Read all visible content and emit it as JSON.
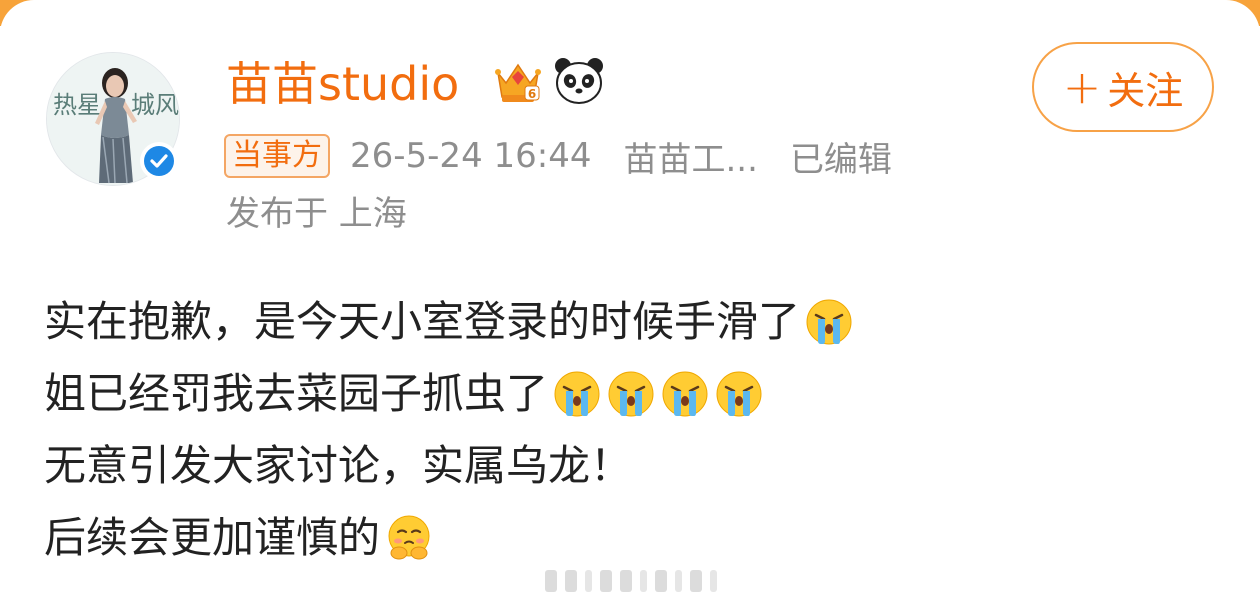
{
  "post": {
    "user": {
      "name": "苗苗studio",
      "avatar_text_left": "热",
      "avatar_text_right": "城风"
    },
    "follow_label": "关注",
    "follow_plus": "+",
    "badge": "当事方",
    "timestamp": "26-5-24 16:44",
    "source": "苗苗工...",
    "edited": "已编辑",
    "location": "发布于 上海",
    "lines": [
      "实在抱歉，是今天小室登录的时候手滑了",
      "姐已经罚我去菜园子抓虫了",
      "无意引发大家讨论，实属乌龙！",
      "后续会更加谨慎的"
    ]
  },
  "icons": {
    "crown": "crown-level-6-icon",
    "panda": "panda-icon",
    "verified": "verified-check-icon",
    "crying": "crying-face-emoji",
    "shy": "shy-face-emoji"
  },
  "colors": {
    "accent": "#f26d0f",
    "follow_border": "#f7a247",
    "meta_gray": "#8e8e8e",
    "verified_blue": "#1e88e5",
    "top_bar": "#f7a33a"
  }
}
